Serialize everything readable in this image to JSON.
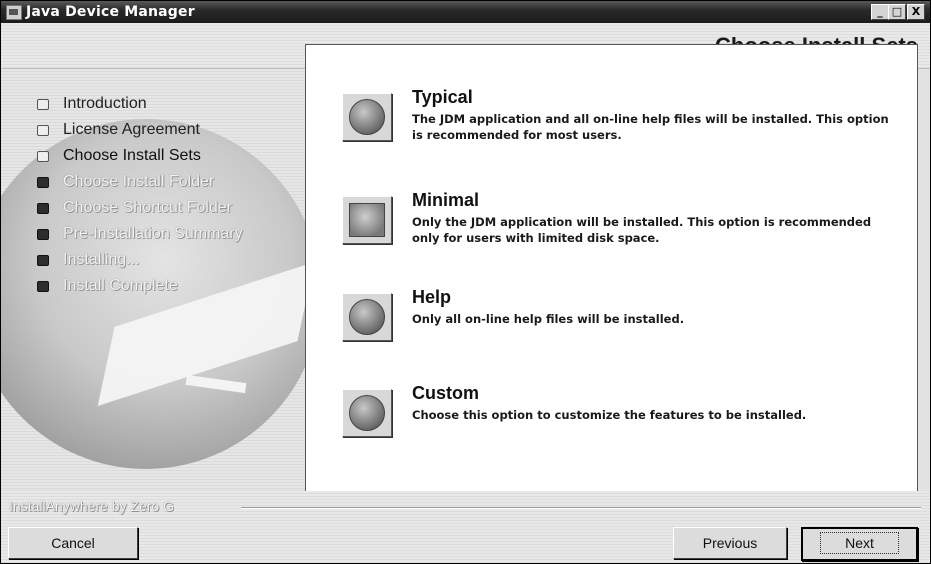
{
  "window": {
    "title": "Java Device Manager",
    "controls": {
      "minimize": "_",
      "maximize": "□",
      "close": "X"
    }
  },
  "header": {
    "step_title": "Choose Install Sets"
  },
  "steps": [
    {
      "label": "Introduction",
      "state": "done"
    },
    {
      "label": "License Agreement",
      "state": "done"
    },
    {
      "label": "Choose Install Sets",
      "state": "current"
    },
    {
      "label": "Choose Install Folder",
      "state": "pending"
    },
    {
      "label": "Choose Shortcut Folder",
      "state": "pending"
    },
    {
      "label": "Pre-Installation Summary",
      "state": "pending"
    },
    {
      "label": "Installing...",
      "state": "pending"
    },
    {
      "label": "Install Complete",
      "state": "pending"
    }
  ],
  "options": [
    {
      "title": "Typical",
      "icon": "circle-button-icon",
      "description": "The JDM application and all on-line help files will be installed. This option is recommended for most users."
    },
    {
      "title": "Minimal",
      "icon": "square-button-icon",
      "description": "Only the JDM application will be installed.  This option is recommended only for users with limited disk space."
    },
    {
      "title": "Help",
      "icon": "circle-button-icon",
      "description": "Only all on-line help files will be installed."
    },
    {
      "title": "Custom",
      "icon": "circle-button-icon",
      "description": "Choose this option to customize the features to be installed."
    }
  ],
  "footer": {
    "branding": "InstallAnywhere by Zero G",
    "cancel_label": "Cancel",
    "previous_label": "Previous",
    "next_label": "Next"
  }
}
